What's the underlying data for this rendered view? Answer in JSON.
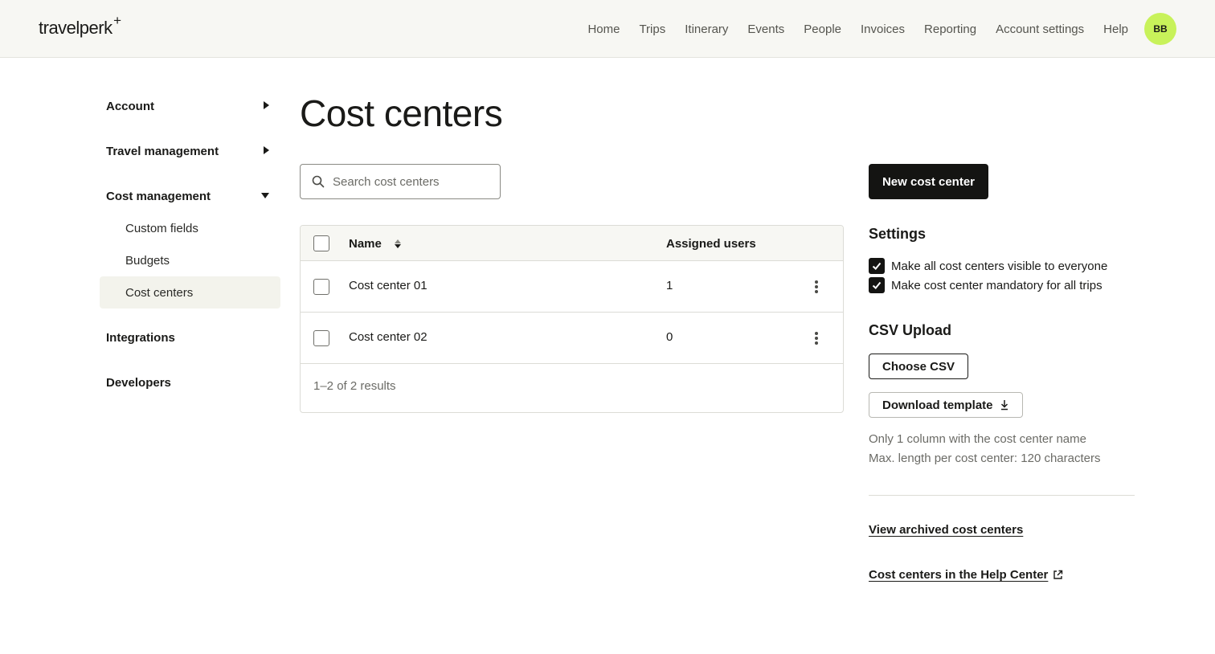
{
  "header": {
    "logo": "travelperk",
    "logo_plus": "+",
    "nav": [
      "Home",
      "Trips",
      "Itinerary",
      "Events",
      "People",
      "Invoices",
      "Reporting",
      "Account settings",
      "Help"
    ],
    "avatar_initials": "BB"
  },
  "sidebar": {
    "groups": [
      {
        "label": "Account",
        "state": "collapsed"
      },
      {
        "label": "Travel management",
        "state": "collapsed"
      },
      {
        "label": "Cost management",
        "state": "expanded"
      }
    ],
    "cost_management_items": [
      "Custom fields",
      "Budgets",
      "Cost centers"
    ],
    "active_item": "Cost centers",
    "bottom_groups": [
      "Integrations",
      "Developers"
    ]
  },
  "main": {
    "title": "Cost centers",
    "search": {
      "placeholder": "Search cost centers",
      "value": ""
    },
    "table": {
      "columns": [
        "Name",
        "Assigned users"
      ],
      "rows": [
        {
          "name": "Cost center 01",
          "assigned_users": "1"
        },
        {
          "name": "Cost center 02",
          "assigned_users": "0"
        }
      ],
      "pagination": "1–2 of 2 results"
    }
  },
  "panel": {
    "new_button": "New cost center",
    "settings_title": "Settings",
    "settings": [
      {
        "label": "Make all cost centers visible to everyone",
        "checked": true
      },
      {
        "label": "Make cost center mandatory for all trips",
        "checked": true
      }
    ],
    "csv_title": "CSV Upload",
    "choose_csv": "Choose CSV",
    "download_template": "Download template",
    "hint_1": "Only 1 column with the cost center name",
    "hint_2": "Max. length per cost center: 120 characters",
    "archived_link": "View archived cost centers",
    "help_link": "Cost centers in the Help Center"
  },
  "colors": {
    "accent_avatar": "#c8f25a",
    "primary_button": "#141412",
    "header_bg": "#f7f7f3",
    "active_item_bg": "#f3f3ec"
  }
}
